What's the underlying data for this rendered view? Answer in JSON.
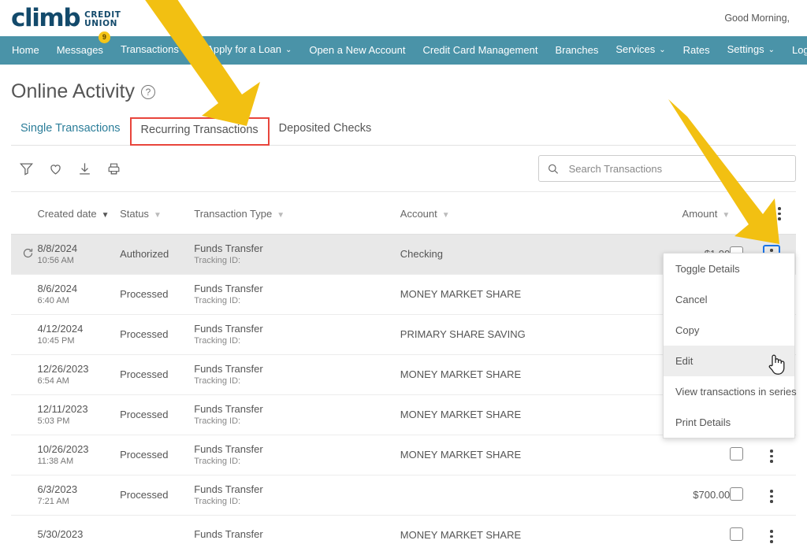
{
  "header": {
    "logo_word": "climb",
    "logo_line1": "CREDIT",
    "logo_line2": "UNION",
    "greeting": "Good Morning,"
  },
  "nav": {
    "items": [
      {
        "label": "Home",
        "caret": false,
        "badge": null
      },
      {
        "label": "Messages",
        "caret": false,
        "badge": "9"
      },
      {
        "label": "Transactions",
        "caret": true,
        "badge": null
      },
      {
        "label": "Apply for a Loan",
        "caret": true,
        "badge": null
      },
      {
        "label": "Open a New Account",
        "caret": false,
        "badge": null
      },
      {
        "label": "Credit Card Management",
        "caret": false,
        "badge": null
      },
      {
        "label": "Branches",
        "caret": false,
        "badge": null
      },
      {
        "label": "Services",
        "caret": true,
        "badge": null
      },
      {
        "label": "Rates",
        "caret": false,
        "badge": null
      },
      {
        "label": "Settings",
        "caret": true,
        "badge": null
      },
      {
        "label": "Log Off",
        "caret": false,
        "badge": null
      }
    ],
    "caret_glyph": "⌄"
  },
  "page": {
    "title": "Online Activity",
    "help_glyph": "?"
  },
  "tabs": [
    {
      "label": "Single Transactions",
      "active": true,
      "highlighted": false
    },
    {
      "label": "Recurring Transactions",
      "active": false,
      "highlighted": true
    },
    {
      "label": "Deposited Checks",
      "active": false,
      "highlighted": false
    }
  ],
  "toolbar": {
    "icons": [
      "filter-icon",
      "favorite-icon",
      "download-icon",
      "print-icon"
    ],
    "search": {
      "placeholder": "Search Transactions",
      "value": ""
    }
  },
  "table": {
    "headers": {
      "created_date": "Created date",
      "status": "Status",
      "transaction_type": "Transaction Type",
      "account": "Account",
      "amount": "Amount"
    },
    "tracking_label": "Tracking ID:",
    "rows": [
      {
        "recurring": true,
        "date": "8/8/2024",
        "time": "10:56 AM",
        "status": "Authorized",
        "type": "Funds Transfer",
        "tracking": "Tracking ID:",
        "account": "Checking",
        "amount": "$1.00",
        "selected": true,
        "kebab_focused": true
      },
      {
        "recurring": false,
        "date": "8/6/2024",
        "time": "6:40 AM",
        "status": "Processed",
        "type": "Funds Transfer",
        "tracking": "Tracking ID:",
        "account": "MONEY MARKET SHARE",
        "amount": "",
        "selected": false,
        "kebab_focused": false
      },
      {
        "recurring": false,
        "date": "4/12/2024",
        "time": "10:45 PM",
        "status": "Processed",
        "type": "Funds Transfer",
        "tracking": "Tracking ID:",
        "account": "PRIMARY SHARE SAVING",
        "amount": "",
        "selected": false,
        "kebab_focused": false
      },
      {
        "recurring": false,
        "date": "12/26/2023",
        "time": "6:54 AM",
        "status": "Processed",
        "type": "Funds Transfer",
        "tracking": "Tracking ID:",
        "account": "MONEY MARKET SHARE",
        "amount": "",
        "selected": false,
        "kebab_focused": false
      },
      {
        "recurring": false,
        "date": "12/11/2023",
        "time": "5:03 PM",
        "status": "Processed",
        "type": "Funds Transfer",
        "tracking": "Tracking ID:",
        "account": "MONEY MARKET SHARE",
        "amount": "",
        "selected": false,
        "kebab_focused": false
      },
      {
        "recurring": false,
        "date": "10/26/2023",
        "time": "11:38 AM",
        "status": "Processed",
        "type": "Funds Transfer",
        "tracking": "Tracking ID:",
        "account": "MONEY MARKET SHARE",
        "amount": "",
        "selected": false,
        "kebab_focused": false
      },
      {
        "recurring": false,
        "date": "6/3/2023",
        "time": "7:21 AM",
        "status": "Processed",
        "type": "Funds Transfer",
        "tracking": "Tracking ID:",
        "account": "",
        "amount": "$700.00",
        "selected": false,
        "kebab_focused": false
      },
      {
        "recurring": false,
        "date": "5/30/2023",
        "time": "",
        "status": "",
        "type": "Funds Transfer",
        "tracking": "",
        "account": "MONEY MARKET SHARE",
        "amount": "",
        "selected": false,
        "kebab_focused": false
      }
    ]
  },
  "context_menu": {
    "items": [
      {
        "label": "Toggle Details",
        "hover": false
      },
      {
        "label": "Cancel",
        "hover": false
      },
      {
        "label": "Copy",
        "hover": false
      },
      {
        "label": "Edit",
        "hover": true
      },
      {
        "label": "View transactions in series",
        "hover": false
      },
      {
        "label": "Print Details",
        "hover": false
      }
    ]
  },
  "annotations": {
    "arrow_color": "#f2c012",
    "highlight_box_color": "#e8453c"
  }
}
